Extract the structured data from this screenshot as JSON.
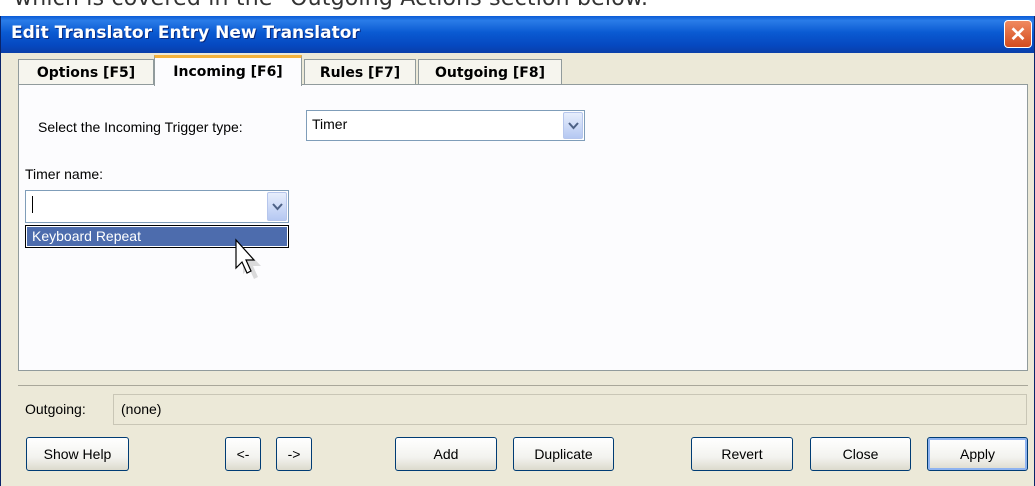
{
  "page_caption": {
    "before": "which is covered in the \"Outgoing Actions",
    "link": " ",
    "after": "section below."
  },
  "window": {
    "title": "Edit Translator Entry New Translator",
    "close_glyph": "✕"
  },
  "tabs": [
    {
      "label": "Options [F5]",
      "active": false
    },
    {
      "label": "Incoming [F6]",
      "active": true
    },
    {
      "label": "Rules [F7]",
      "active": false
    },
    {
      "label": "Outgoing [F8]",
      "active": false
    }
  ],
  "incoming": {
    "trigger_label": "Select the Incoming Trigger type:",
    "trigger_value": "Timer",
    "timer_name_label": "Timer name:",
    "timer_name_value": "",
    "dropdown_options": [
      "Keyboard Repeat"
    ]
  },
  "status": {
    "outgoing_label": "Outgoing:",
    "outgoing_value": "(none)"
  },
  "buttons": {
    "show_help": "Show Help",
    "prev": "<-",
    "next": "->",
    "add": "Add",
    "duplicate": "Duplicate",
    "revert": "Revert",
    "close": "Close",
    "apply": "Apply"
  },
  "icons": {
    "close": "close-icon",
    "combo_arrow": "chevron-down-icon",
    "cursor": "mouse-pointer-icon"
  },
  "colors": {
    "titlebar": "#0a5ad2",
    "active_tab_accent": "#f4b23c",
    "selection": "#4d6cad",
    "close_button": "#d34b1e"
  }
}
